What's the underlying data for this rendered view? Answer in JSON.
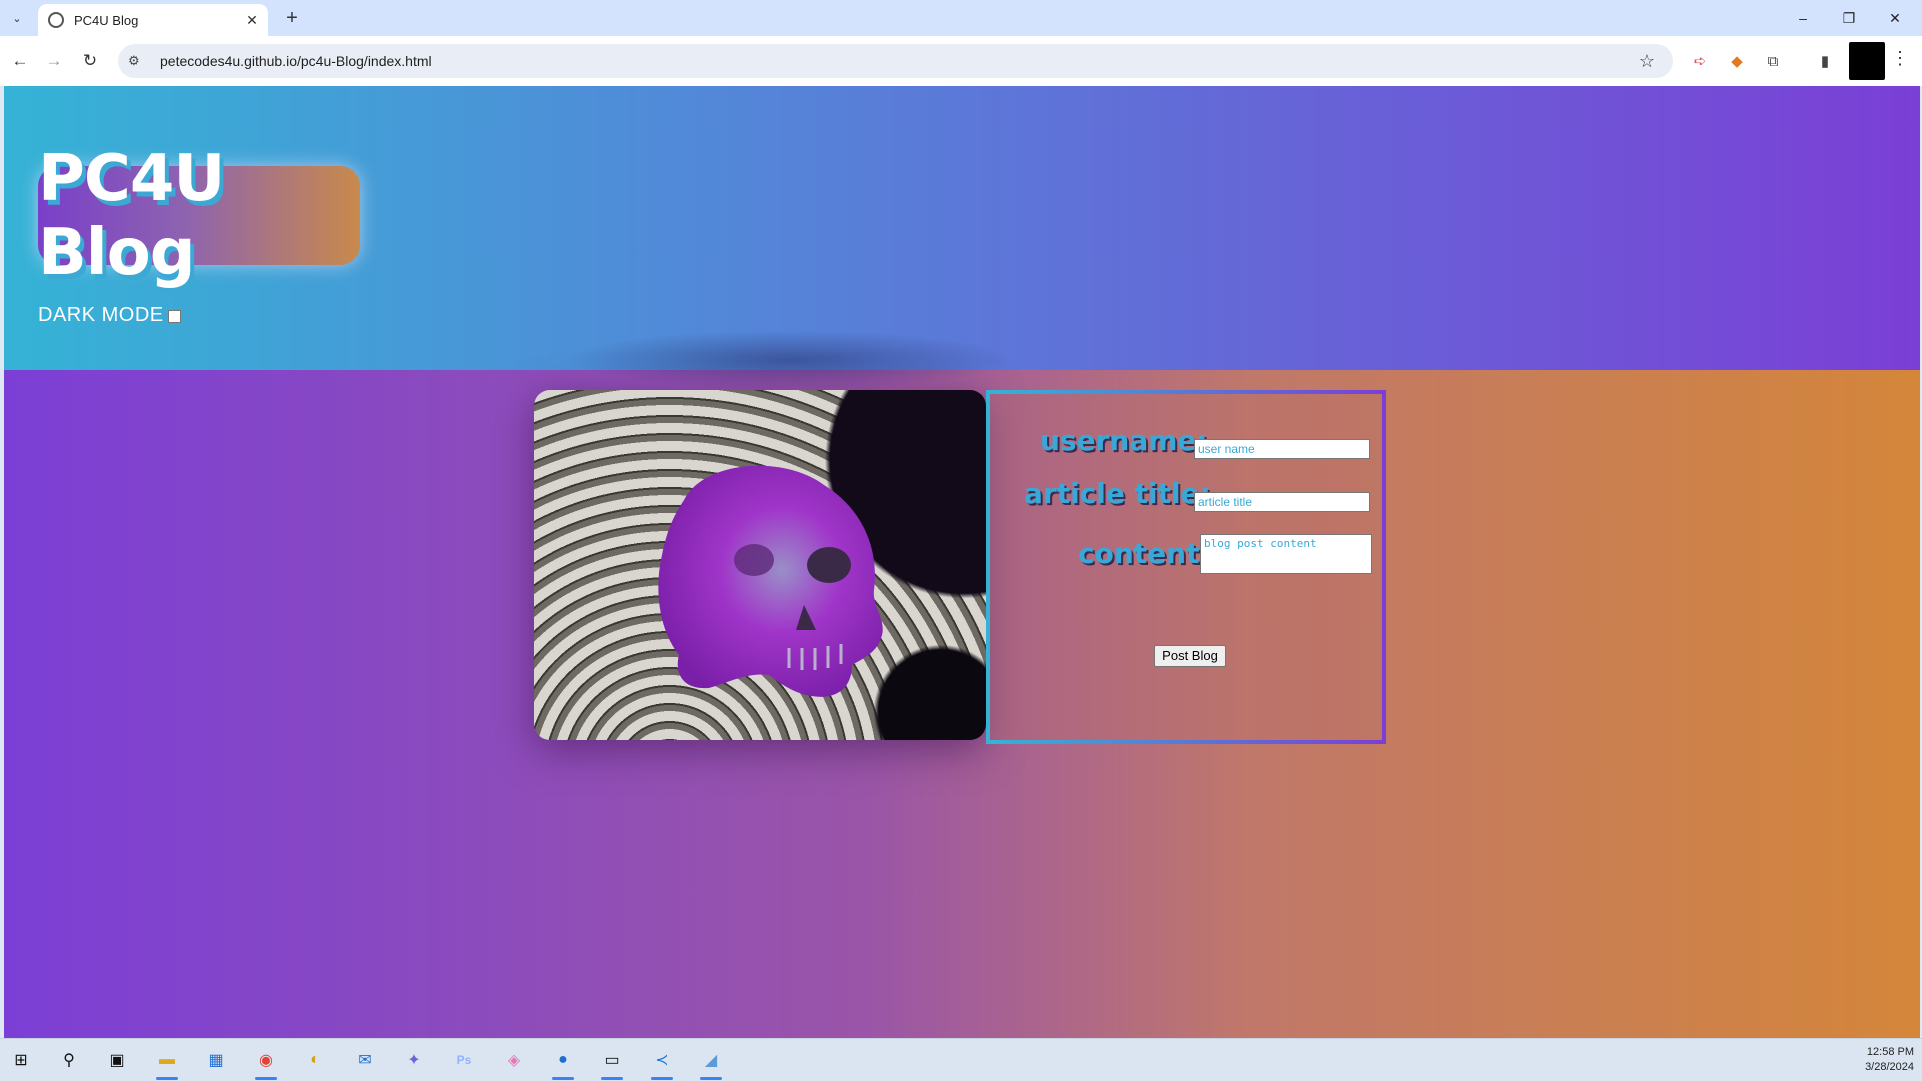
{
  "browser": {
    "tab_title": "PC4U Blog",
    "tab_close": "✕",
    "new_tab": "+",
    "url": "petecodes4u.github.io/pc4u-Blog/index.html",
    "window_controls": [
      "–",
      "❐",
      "✕"
    ]
  },
  "header": {
    "logo_text": "PC4U Blog",
    "dark_mode_label": "DARK MODE",
    "dark_mode_checked": false
  },
  "form": {
    "username_label": "username:",
    "username_placeholder": "user name",
    "title_label": "article title:",
    "title_placeholder": "article title",
    "content_label": "content:",
    "content_placeholder": "blog post content",
    "submit_label": "Post Blog"
  },
  "image": {
    "icon": "skull-fractal-image"
  },
  "taskbar": {
    "icons": [
      "windows-start-icon",
      "search-icon",
      "task-view-icon",
      "file-explorer-icon",
      "store-icon",
      "chrome-icon",
      "app-icon",
      "mail-icon",
      "copilot-icon",
      "photoshop-icon",
      "gem-icon",
      "zoom-icon",
      "terminal-icon",
      "vscode-icon",
      "app2-icon"
    ],
    "time": "12:58 PM",
    "date": "3/28/2024"
  },
  "colors": {
    "header_gradient": [
      "#35b3d6",
      "#5584d8",
      "#7b3fd6"
    ],
    "body_gradient": [
      "#7b3fd6",
      "#9a55a8",
      "#c0786a",
      "#d4863a"
    ],
    "label_color": "#39a8d6"
  }
}
